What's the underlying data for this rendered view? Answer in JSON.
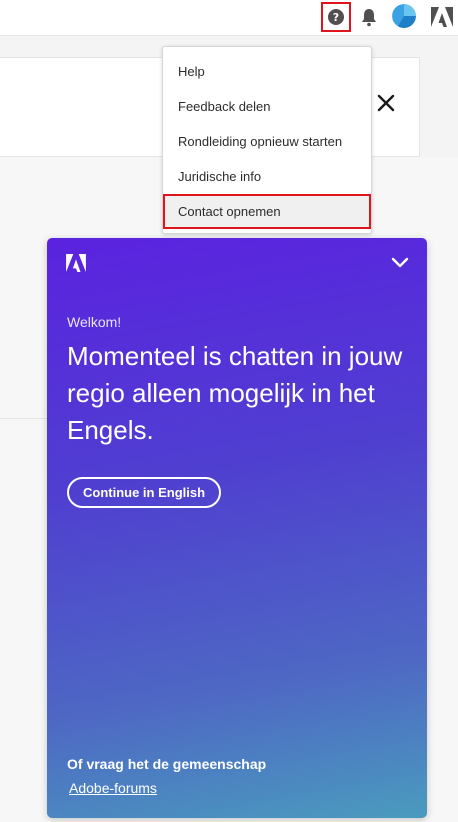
{
  "header": {
    "help_icon_label": "?",
    "icons": [
      "help-icon",
      "bell-icon",
      "avatar",
      "adobe-logo-icon"
    ]
  },
  "help_menu": {
    "items": [
      {
        "label": "Help"
      },
      {
        "label": "Feedback delen"
      },
      {
        "label": "Rondleiding opnieuw starten"
      },
      {
        "label": "Juridische info"
      },
      {
        "label": "Contact opnemen"
      }
    ],
    "highlighted_item": "Contact opnemen"
  },
  "chat": {
    "welcome": "Welkom!",
    "message": "Momenteel is chatten in jouw regio alleen mogelijk in het Engels.",
    "continue_button": "Continue in English",
    "community_text": "Of vraag het de gemeenschap",
    "forums_link": "Adobe-forums"
  },
  "colors": {
    "highlight_red": "#e0141b",
    "chat_gradient_top": "#5b22e0",
    "chat_gradient_bottom": "#4a9bbe"
  }
}
